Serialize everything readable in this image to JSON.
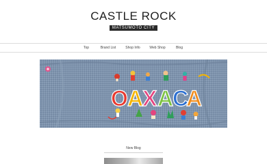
{
  "header": {
    "title": "CASTLE ROCK",
    "subtitle": "MATSUMOTO CITY"
  },
  "nav": {
    "items": [
      {
        "label": "Top"
      },
      {
        "label": "Brand List"
      },
      {
        "label": "Shop Info"
      },
      {
        "label": "Web Shop"
      },
      {
        "label": "Blog"
      }
    ]
  },
  "hero": {
    "embroidery_text": "OAXACA",
    "colors": {
      "denim": "#7e93ad",
      "letter_O": "#e8392f",
      "letter_A1": "#f4b400",
      "letter_X": "#e4457f",
      "letter_A2": "#7cc242",
      "letter_C": "#2c6fd1",
      "letter_A3": "#f08c1d"
    }
  },
  "section": {
    "new_blog_label": "New Blog"
  }
}
